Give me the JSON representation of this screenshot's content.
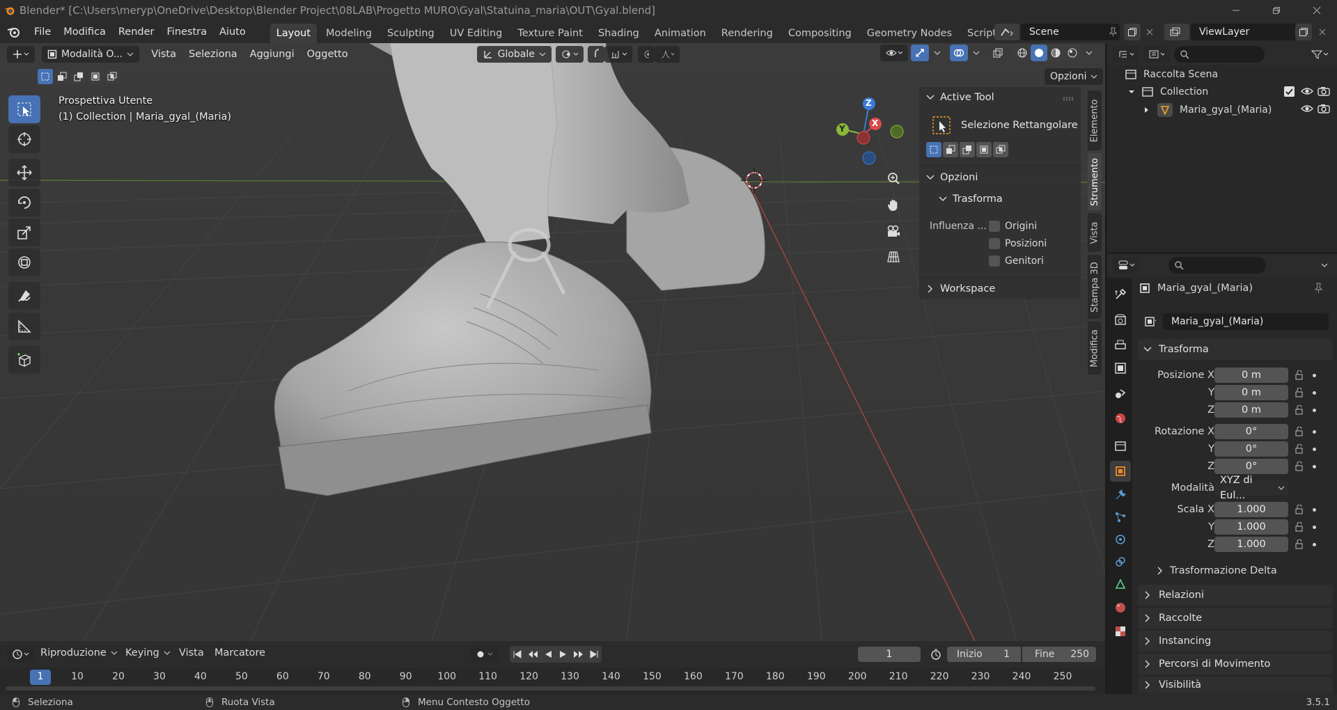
{
  "title_bar": {
    "title": "Blender* [C:\\Users\\meryp\\OneDrive\\Desktop\\Blender Project\\08LAB\\Progetto MURO\\Gyal\\Statuina_maria\\OUT\\Gyal.blend]"
  },
  "menu": [
    "File",
    "Modifica",
    "Render",
    "Finestra",
    "Aiuto"
  ],
  "workspaces": [
    {
      "label": "Layout",
      "active": true
    },
    {
      "label": "Modeling"
    },
    {
      "label": "Sculpting"
    },
    {
      "label": "UV Editing"
    },
    {
      "label": "Texture Paint"
    },
    {
      "label": "Shading"
    },
    {
      "label": "Animation"
    },
    {
      "label": "Rendering"
    },
    {
      "label": "Compositing"
    },
    {
      "label": "Geometry Nodes"
    },
    {
      "label": "Scripting"
    }
  ],
  "scene": {
    "name": "Scene"
  },
  "view_layer": {
    "name": "ViewLayer"
  },
  "viewport_header": {
    "mode": "Modalità O...",
    "menus": [
      "Vista",
      "Seleziona",
      "Aggiungi",
      "Oggetto"
    ],
    "orientation": "Globale",
    "options": "Opzioni"
  },
  "viewport": {
    "view_name": "Prospettiva Utente",
    "context": "(1) Collection | Maria_gyal_(Maria)",
    "gizmo": {
      "z": "Z",
      "x": "X",
      "y": "Y"
    }
  },
  "npanel": {
    "active_tool_header": "Active Tool",
    "tool_name": "Selezione Rettangolare",
    "options_header": "Opzioni",
    "transform_header": "Trasforma",
    "influence_label": "Influenza ...",
    "checks": [
      "Origini",
      "Posizioni",
      "Genitori"
    ],
    "workspace_header": "Workspace",
    "tabs": [
      {
        "label": "Elemento"
      },
      {
        "label": "Strumento",
        "active": true
      },
      {
        "label": "Vista"
      },
      {
        "label": "Stampa 3D"
      },
      {
        "label": "Modifica"
      }
    ]
  },
  "outliner": {
    "root": "Raccolta Scena",
    "collection": "Collection",
    "object": "Maria_gyal_(Maria)"
  },
  "properties": {
    "object_name": "Maria_gyal_(Maria)",
    "datablock": "Maria_gyal_(Maria)",
    "transform_header": "Trasforma",
    "location": {
      "label": "Posizione X",
      "y_label": "Y",
      "z_label": "Z",
      "x": "0 m",
      "y": "0 m",
      "z": "0 m"
    },
    "rotation": {
      "label": "Rotazione X",
      "y_label": "Y",
      "z_label": "Z",
      "x": "0°",
      "y": "0°",
      "z": "0°"
    },
    "mode_label": "Modalità",
    "mode_value": "XYZ di Eul...",
    "scale": {
      "label": "Scala X",
      "y_label": "Y",
      "z_label": "Z",
      "x": "1.000",
      "y": "1.000",
      "z": "1.000"
    },
    "delta": "Trasformazione Delta",
    "sections": [
      "Relazioni",
      "Raccolte",
      "Instancing",
      "Percorsi di Movimento",
      "Visibilità"
    ]
  },
  "timeline": {
    "menus": [
      "Riproduzione",
      "Keying",
      "Vista",
      "Marcatore"
    ],
    "current_frame": "1",
    "start_label": "Inizio",
    "start": "1",
    "end_label": "Fine",
    "end": "250",
    "ticks": [
      "1",
      "10",
      "20",
      "30",
      "40",
      "50",
      "60",
      "70",
      "80",
      "90",
      "100",
      "110",
      "120",
      "130",
      "140",
      "150",
      "160",
      "170",
      "180",
      "190",
      "200",
      "210",
      "220",
      "230",
      "240",
      "250"
    ]
  },
  "status_bar": {
    "left": "Seleziona",
    "middle": "Ruota Vista",
    "right": "Menu Contesto Oggetto",
    "version": "3.5.1"
  },
  "colors": {
    "accent": "#4772b3",
    "axis_x": "#d64b4b",
    "axis_y": "#8cb83a",
    "axis_z": "#3c7bd8",
    "active_tool": "#f0a030"
  }
}
